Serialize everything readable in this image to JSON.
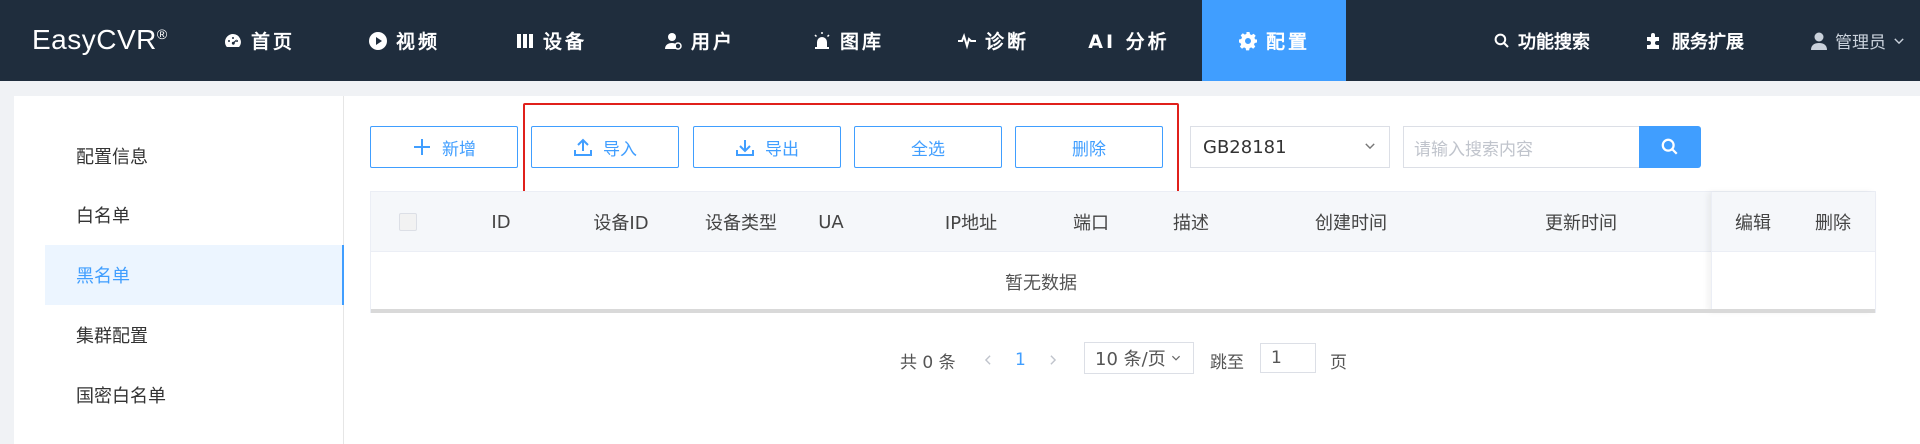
{
  "brand": {
    "name": "EasyCVR",
    "mark": "®"
  },
  "nav": [
    {
      "label": "首页",
      "icon": "dashboard-icon"
    },
    {
      "label": "视频",
      "icon": "play-icon"
    },
    {
      "label": "设备",
      "icon": "device-icon"
    },
    {
      "label": "用户",
      "icon": "user-icon"
    },
    {
      "label": "图库",
      "icon": "alarm-light-icon"
    },
    {
      "label": "诊断",
      "icon": "pulse-icon"
    },
    {
      "label": "AI 分析",
      "icon": ""
    },
    {
      "label": "配置",
      "icon": "gear-icon",
      "active": true
    }
  ],
  "header_right": {
    "search_label": "功能搜索",
    "extend_label": "服务扩展",
    "user_label": "管理员"
  },
  "sidebar": {
    "items": [
      {
        "label": "配置信息"
      },
      {
        "label": "白名单"
      },
      {
        "label": "黑名单",
        "active": true
      },
      {
        "label": "集群配置"
      },
      {
        "label": "国密白名单"
      }
    ]
  },
  "toolbar": {
    "add_label": "新增",
    "import_label": "导入",
    "export_label": "导出",
    "select_all_label": "全选",
    "delete_label": "删除",
    "protocol_value": "GB28181",
    "search_placeholder": "请输入搜索内容"
  },
  "table": {
    "columns": [
      "ID",
      "设备ID",
      "设备类型",
      "UA",
      "IP地址",
      "端口",
      "描述",
      "创建时间",
      "更新时间",
      "编辑",
      "删除"
    ],
    "empty_text": "暂无数据"
  },
  "pagination": {
    "total_text": "共 0 条",
    "current_page": "1",
    "page_size": "10 条/页",
    "goto_label": "跳至",
    "goto_value": "1",
    "page_suffix": "页"
  },
  "colors": {
    "nav_bg": "#1f2d3d",
    "accent": "#409eff",
    "highlight_border": "#e0201b"
  }
}
